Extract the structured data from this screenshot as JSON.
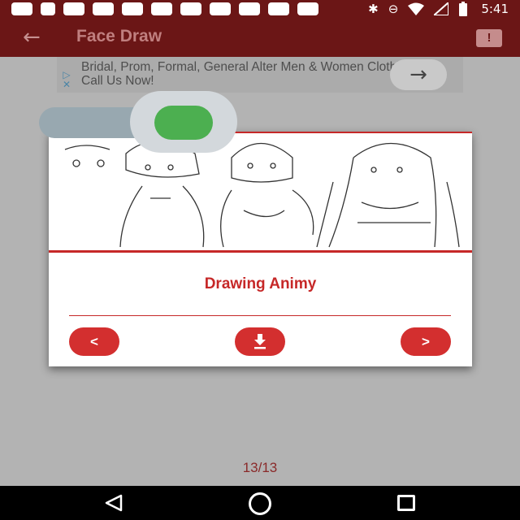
{
  "status_bar": {
    "time": "5:41",
    "left_icons": [
      "chat-icon",
      "facebook-icon",
      "voicemail-icon",
      "voicemail-icon",
      "voicemail-icon",
      "voicemail-icon",
      "voicemail-icon",
      "voicemail-icon",
      "voicemail-icon",
      "voicemail-icon",
      "voicemail-icon"
    ],
    "right_icons": [
      "bluetooth-icon",
      "do-not-disturb-icon",
      "wifi-icon",
      "signal-icon",
      "battery-icon"
    ]
  },
  "app_bar": {
    "title": "Face Draw",
    "back_icon": "arrow-back-icon",
    "report_icon": "report-icon",
    "report_glyph": "!"
  },
  "ad": {
    "text": "Bridal, Prom, Formal, General Alter Men & Women Clothing. Call Us Now!",
    "badge": "adchoices-icon",
    "arrow_glyph": "→"
  },
  "toggle": {
    "state": "on",
    "thumb_color": "#4caf50"
  },
  "dialog": {
    "caption": "Drawing Animy",
    "prev_label": "<",
    "next_label": ">",
    "download_icon": "download-icon"
  },
  "page_counter": "13/13",
  "colors": {
    "brand": "#6b1616",
    "accent": "#c62828",
    "button": "#d32f2f"
  }
}
